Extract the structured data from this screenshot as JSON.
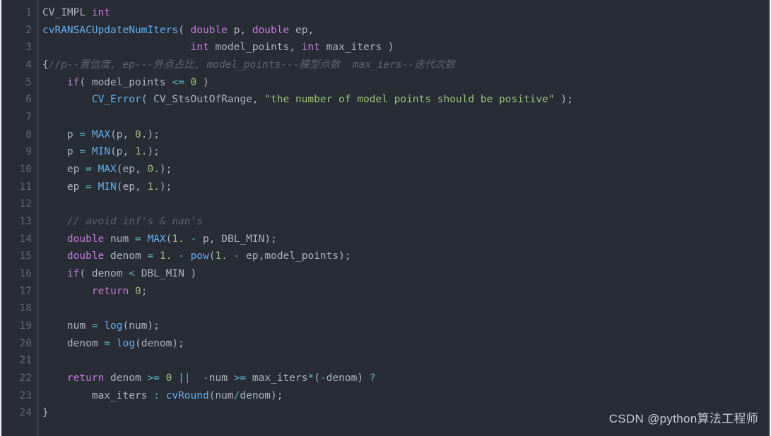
{
  "editor": {
    "language": "C++",
    "theme_name": "One Dark",
    "background_color": "#282c34",
    "gutter_color": "#5c6777",
    "gutter_divider_color": "#4b5263",
    "total_lines": 24,
    "first_visible_line": 1,
    "last_visible_line": 24,
    "colors": {
      "plain": "#abb2bf",
      "keyword": "#c678dd",
      "function": "#61afef",
      "string": "#98c379",
      "number": "#98c379",
      "operator": "#56b6c2",
      "comment": "#5c6370"
    }
  },
  "line_numbers": [
    "1",
    "2",
    "3",
    "4",
    "5",
    "6",
    "7",
    "8",
    "9",
    "10",
    "11",
    "12",
    "13",
    "14",
    "15",
    "16",
    "17",
    "18",
    "19",
    "20",
    "21",
    "22",
    "23",
    "24"
  ],
  "code_lines": [
    {
      "number": "1",
      "tokens": [
        {
          "text": "CV_IMPL ",
          "cls": "t-macro"
        },
        {
          "text": "int",
          "cls": "t-kw"
        }
      ]
    },
    {
      "number": "2",
      "tokens": [
        {
          "text": "cvRANSACUpdateNumIters",
          "cls": "t-fn"
        },
        {
          "text": "( ",
          "cls": "t-punct"
        },
        {
          "text": "double",
          "cls": "t-kw"
        },
        {
          "text": " p, ",
          "cls": "t-plain"
        },
        {
          "text": "double",
          "cls": "t-kw"
        },
        {
          "text": " ep,",
          "cls": "t-plain"
        }
      ]
    },
    {
      "number": "3",
      "tokens": [
        {
          "text": "                        ",
          "cls": "t-plain"
        },
        {
          "text": "int",
          "cls": "t-kw"
        },
        {
          "text": " model_points, ",
          "cls": "t-plain"
        },
        {
          "text": "int",
          "cls": "t-kw"
        },
        {
          "text": " max_iters )",
          "cls": "t-plain"
        }
      ]
    },
    {
      "number": "4",
      "tokens": [
        {
          "text": "{",
          "cls": "t-punct"
        },
        {
          "text": "//p--置信度, ep---外点占比, model_points---模型点数  max_iers--迭代次数",
          "cls": "t-comment"
        }
      ]
    },
    {
      "number": "5",
      "tokens": [
        {
          "text": "    ",
          "cls": "t-plain"
        },
        {
          "text": "if",
          "cls": "t-kw"
        },
        {
          "text": "( model_points ",
          "cls": "t-plain"
        },
        {
          "text": "<=",
          "cls": "t-op"
        },
        {
          "text": " ",
          "cls": "t-plain"
        },
        {
          "text": "0",
          "cls": "t-num"
        },
        {
          "text": " )",
          "cls": "t-plain"
        }
      ]
    },
    {
      "number": "6",
      "tokens": [
        {
          "text": "        ",
          "cls": "t-plain"
        },
        {
          "text": "CV_Error",
          "cls": "t-fn"
        },
        {
          "text": "( CV_StsOutOfRange, ",
          "cls": "t-plain"
        },
        {
          "text": "\"the number of model points should be positive\"",
          "cls": "t-str"
        },
        {
          "text": " );",
          "cls": "t-plain"
        }
      ]
    },
    {
      "number": "7",
      "tokens": []
    },
    {
      "number": "8",
      "tokens": [
        {
          "text": "    p ",
          "cls": "t-plain"
        },
        {
          "text": "=",
          "cls": "t-op"
        },
        {
          "text": " ",
          "cls": "t-plain"
        },
        {
          "text": "MAX",
          "cls": "t-fn"
        },
        {
          "text": "(p, ",
          "cls": "t-plain"
        },
        {
          "text": "0.",
          "cls": "t-num"
        },
        {
          "text": ");",
          "cls": "t-plain"
        }
      ]
    },
    {
      "number": "9",
      "tokens": [
        {
          "text": "    p ",
          "cls": "t-plain"
        },
        {
          "text": "=",
          "cls": "t-op"
        },
        {
          "text": " ",
          "cls": "t-plain"
        },
        {
          "text": "MIN",
          "cls": "t-fn"
        },
        {
          "text": "(p, ",
          "cls": "t-plain"
        },
        {
          "text": "1.",
          "cls": "t-num"
        },
        {
          "text": ");",
          "cls": "t-plain"
        }
      ]
    },
    {
      "number": "10",
      "tokens": [
        {
          "text": "    ep ",
          "cls": "t-plain"
        },
        {
          "text": "=",
          "cls": "t-op"
        },
        {
          "text": " ",
          "cls": "t-plain"
        },
        {
          "text": "MAX",
          "cls": "t-fn"
        },
        {
          "text": "(ep, ",
          "cls": "t-plain"
        },
        {
          "text": "0.",
          "cls": "t-num"
        },
        {
          "text": ");",
          "cls": "t-plain"
        }
      ]
    },
    {
      "number": "11",
      "tokens": [
        {
          "text": "    ep ",
          "cls": "t-plain"
        },
        {
          "text": "=",
          "cls": "t-op"
        },
        {
          "text": " ",
          "cls": "t-plain"
        },
        {
          "text": "MIN",
          "cls": "t-fn"
        },
        {
          "text": "(ep, ",
          "cls": "t-plain"
        },
        {
          "text": "1.",
          "cls": "t-num"
        },
        {
          "text": ");",
          "cls": "t-plain"
        }
      ]
    },
    {
      "number": "12",
      "tokens": []
    },
    {
      "number": "13",
      "tokens": [
        {
          "text": "    ",
          "cls": "t-plain"
        },
        {
          "text": "// avoid inf's & nan's",
          "cls": "t-comment"
        }
      ]
    },
    {
      "number": "14",
      "tokens": [
        {
          "text": "    ",
          "cls": "t-plain"
        },
        {
          "text": "double",
          "cls": "t-kw"
        },
        {
          "text": " num ",
          "cls": "t-plain"
        },
        {
          "text": "=",
          "cls": "t-op"
        },
        {
          "text": " ",
          "cls": "t-plain"
        },
        {
          "text": "MAX",
          "cls": "t-fn"
        },
        {
          "text": "(",
          "cls": "t-plain"
        },
        {
          "text": "1.",
          "cls": "t-num"
        },
        {
          "text": " ",
          "cls": "t-plain"
        },
        {
          "text": "-",
          "cls": "t-op"
        },
        {
          "text": " p, DBL_MIN);",
          "cls": "t-plain"
        }
      ]
    },
    {
      "number": "15",
      "tokens": [
        {
          "text": "    ",
          "cls": "t-plain"
        },
        {
          "text": "double",
          "cls": "t-kw"
        },
        {
          "text": " denom ",
          "cls": "t-plain"
        },
        {
          "text": "=",
          "cls": "t-op"
        },
        {
          "text": " ",
          "cls": "t-plain"
        },
        {
          "text": "1.",
          "cls": "t-num"
        },
        {
          "text": " ",
          "cls": "t-plain"
        },
        {
          "text": "-",
          "cls": "t-op"
        },
        {
          "text": " ",
          "cls": "t-plain"
        },
        {
          "text": "pow",
          "cls": "t-fn"
        },
        {
          "text": "(",
          "cls": "t-plain"
        },
        {
          "text": "1.",
          "cls": "t-num"
        },
        {
          "text": " ",
          "cls": "t-plain"
        },
        {
          "text": "-",
          "cls": "t-op"
        },
        {
          "text": " ep,model_points);",
          "cls": "t-plain"
        }
      ]
    },
    {
      "number": "16",
      "tokens": [
        {
          "text": "    ",
          "cls": "t-plain"
        },
        {
          "text": "if",
          "cls": "t-kw"
        },
        {
          "text": "( denom ",
          "cls": "t-plain"
        },
        {
          "text": "<",
          "cls": "t-op"
        },
        {
          "text": " DBL_MIN )",
          "cls": "t-plain"
        }
      ]
    },
    {
      "number": "17",
      "tokens": [
        {
          "text": "        ",
          "cls": "t-plain"
        },
        {
          "text": "return",
          "cls": "t-kw"
        },
        {
          "text": " ",
          "cls": "t-plain"
        },
        {
          "text": "0",
          "cls": "t-num"
        },
        {
          "text": ";",
          "cls": "t-plain"
        }
      ]
    },
    {
      "number": "18",
      "tokens": []
    },
    {
      "number": "19",
      "tokens": [
        {
          "text": "    num ",
          "cls": "t-plain"
        },
        {
          "text": "=",
          "cls": "t-op"
        },
        {
          "text": " ",
          "cls": "t-plain"
        },
        {
          "text": "log",
          "cls": "t-fn"
        },
        {
          "text": "(num);",
          "cls": "t-plain"
        }
      ]
    },
    {
      "number": "20",
      "tokens": [
        {
          "text": "    denom ",
          "cls": "t-plain"
        },
        {
          "text": "=",
          "cls": "t-op"
        },
        {
          "text": " ",
          "cls": "t-plain"
        },
        {
          "text": "log",
          "cls": "t-fn"
        },
        {
          "text": "(denom);",
          "cls": "t-plain"
        }
      ]
    },
    {
      "number": "21",
      "tokens": []
    },
    {
      "number": "22",
      "tokens": [
        {
          "text": "    ",
          "cls": "t-plain"
        },
        {
          "text": "return",
          "cls": "t-kw"
        },
        {
          "text": " denom ",
          "cls": "t-plain"
        },
        {
          "text": ">=",
          "cls": "t-op"
        },
        {
          "text": " ",
          "cls": "t-plain"
        },
        {
          "text": "0",
          "cls": "t-num"
        },
        {
          "text": " ",
          "cls": "t-plain"
        },
        {
          "text": "||",
          "cls": "t-op"
        },
        {
          "text": "  ",
          "cls": "t-plain"
        },
        {
          "text": "-",
          "cls": "t-op"
        },
        {
          "text": "num ",
          "cls": "t-plain"
        },
        {
          "text": ">=",
          "cls": "t-op"
        },
        {
          "text": " max_iters",
          "cls": "t-plain"
        },
        {
          "text": "*",
          "cls": "t-op"
        },
        {
          "text": "(",
          "cls": "t-plain"
        },
        {
          "text": "-",
          "cls": "t-op"
        },
        {
          "text": "denom) ",
          "cls": "t-plain"
        },
        {
          "text": "?",
          "cls": "t-op"
        }
      ]
    },
    {
      "number": "23",
      "tokens": [
        {
          "text": "        max_iters ",
          "cls": "t-plain"
        },
        {
          "text": ":",
          "cls": "t-op"
        },
        {
          "text": " ",
          "cls": "t-plain"
        },
        {
          "text": "cvRound",
          "cls": "t-fn"
        },
        {
          "text": "(num",
          "cls": "t-plain"
        },
        {
          "text": "/",
          "cls": "t-op"
        },
        {
          "text": "denom);",
          "cls": "t-plain"
        }
      ]
    },
    {
      "number": "24",
      "tokens": [
        {
          "text": "}",
          "cls": "t-punct"
        }
      ]
    }
  ],
  "watermark": {
    "text": "CSDN @python算法工程师",
    "color": "#c4cad3"
  }
}
